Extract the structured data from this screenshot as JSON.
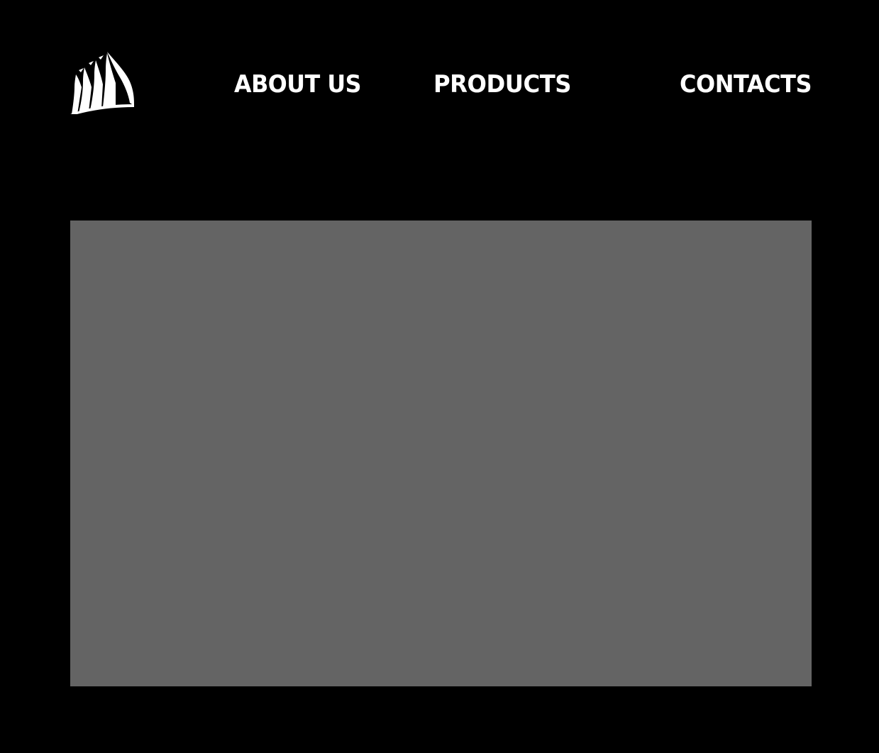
{
  "header": {
    "logo_icon": "sail-ship-logo-icon",
    "nav": {
      "about_label": "ABOUT US",
      "products_label": "PRODUCTS",
      "contacts_label": "CONTACTS"
    }
  },
  "colors": {
    "background": "#000000",
    "text": "#ffffff",
    "hero_placeholder": "#646464"
  }
}
